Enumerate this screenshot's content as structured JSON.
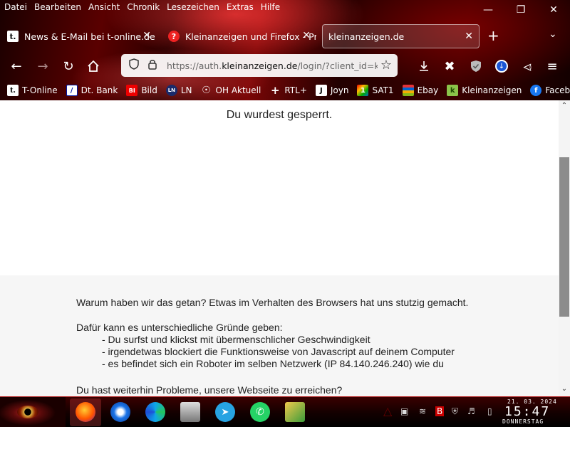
{
  "menubar": {
    "items": [
      "Datei",
      "Bearbeiten",
      "Ansicht",
      "Chronik",
      "Lesezeichen",
      "Extras",
      "Hilfe"
    ]
  },
  "tabs": [
    {
      "label": "News & E-Mail bei t-online.de | ",
      "icon": "t-online-icon",
      "active": false
    },
    {
      "label": "Kleinanzeigen und Firefox - Pro",
      "icon": "firefox-support-icon",
      "active": false
    },
    {
      "label": "kleinanzeigen.de",
      "icon": "none",
      "active": true
    }
  ],
  "urlbar": {
    "prefix": "https://auth.",
    "domain": "kleinanzeigen.de",
    "suffix": "/login/?client_id=ka"
  },
  "bookmarks": [
    {
      "label": "T-Online",
      "icon": "t-online-icon"
    },
    {
      "label": "Dt. Bank",
      "icon": "deutsche-bank-icon"
    },
    {
      "label": "Bild",
      "icon": "bild-icon"
    },
    {
      "label": "LN",
      "icon": "ln-icon"
    },
    {
      "label": "OH Aktuell",
      "icon": "globe-icon"
    },
    {
      "label": "RTL+",
      "icon": "rtl-plus-icon"
    },
    {
      "label": "Joyn",
      "icon": "joyn-icon"
    },
    {
      "label": "SAT1",
      "icon": "sat1-icon"
    },
    {
      "label": "Ebay",
      "icon": "ebay-icon"
    },
    {
      "label": "Kleinanzeigen",
      "icon": "kleinanzeigen-icon"
    },
    {
      "label": "Facebook",
      "icon": "facebook-icon"
    }
  ],
  "page": {
    "heading": "Du wurdest gesperrt.",
    "why": "Warum haben wir das getan? Etwas im Verhalten des Browsers hat uns stutzig gemacht.",
    "reasons_intro": "Dafür kann es unterschiedliche Gründe geben:",
    "reasons": [
      "- Du surfst und klickst mit übermenschlicher Geschwindigkeit",
      "- irgendetwas blockiert die Funktionsweise von Javascript auf deinem Computer",
      "- es befindet sich ein Roboter im selben Netzwerk (IP 84.140.246.240) wie du"
    ],
    "problems": "Du hast weiterhin Probleme, unsere Webseite zu erreichen?"
  },
  "taskbar": {
    "apps": [
      "firefox-icon",
      "thunderbird-icon",
      "edge-icon",
      "scanner-icon",
      "telegram-icon",
      "whatsapp-icon",
      "user-manager-icon"
    ],
    "clock": {
      "date": "21. 03. 2024",
      "time": "15:47",
      "day": "DONNERSTAG"
    }
  },
  "colors": {
    "accent": "#c00000",
    "page_bg": "#ffffff",
    "grey_section": "#f6f6f6"
  }
}
